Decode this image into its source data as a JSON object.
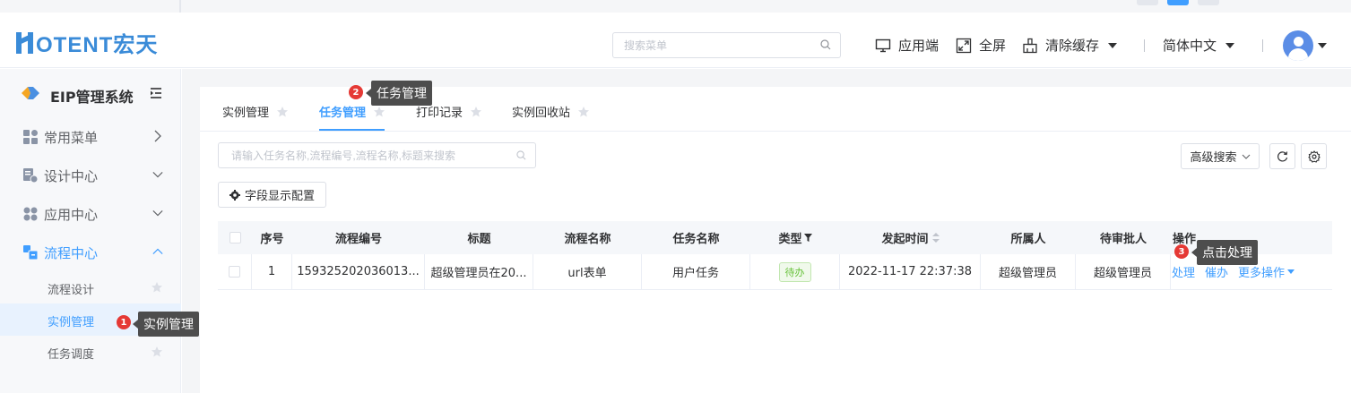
{
  "colors": {
    "brand": "#3a8bd8",
    "accent": "#409eff",
    "tip_bg": "#4d4d4d",
    "badge": "#e53935",
    "status_ok": "#67c23a"
  },
  "header": {
    "logo_text": "OTENT宏天",
    "search_placeholder": "搜索菜单",
    "app_client": "应用端",
    "fullscreen": "全屏",
    "clear_cache": "清除缓存",
    "language": "简体中文"
  },
  "sidebar": {
    "system_title": "EIP管理系统",
    "menu": [
      {
        "label": "常用菜单",
        "icon": "grid-icon",
        "arrow": "chevron-right"
      },
      {
        "label": "设计中心",
        "icon": "design-icon",
        "arrow": "chevron-down"
      },
      {
        "label": "应用中心",
        "icon": "apps-icon",
        "arrow": "chevron-down"
      },
      {
        "label": "流程中心",
        "icon": "flow-icon",
        "arrow": "chevron-up"
      }
    ],
    "sub_menu": [
      {
        "label": "流程设计"
      },
      {
        "label": "实例管理"
      },
      {
        "label": "任务调度"
      }
    ]
  },
  "tooltips": [
    {
      "num": "1",
      "text": "实例管理"
    },
    {
      "num": "2",
      "text": "任务管理"
    },
    {
      "num": "3",
      "text": "点击处理"
    }
  ],
  "tabs": [
    {
      "label": "实例管理"
    },
    {
      "label": "任务管理"
    },
    {
      "label": "打印记录"
    },
    {
      "label": "实例回收站"
    }
  ],
  "toolbar": {
    "search_placeholder": "请输入任务名称,流程编号,流程名称,标题来搜索",
    "advanced_search": "高级搜索",
    "field_config": "字段显示配置"
  },
  "table": {
    "columns": [
      "序号",
      "流程编号",
      "标题",
      "流程名称",
      "任务名称",
      "类型",
      "发起时间",
      "所属人",
      "待审批人",
      "操作"
    ],
    "rows": [
      {
        "index": "1",
        "flow_no": "159325202036013...",
        "title": "超级管理员在20...",
        "flow_name": "url表单",
        "task_name": "用户任务",
        "type": "待办",
        "start_time": "2022-11-17 22:37:38",
        "owner": "超级管理员",
        "approver": "超级管理员",
        "actions": {
          "handle": "处理",
          "urge": "催办",
          "more": "更多操作"
        }
      }
    ]
  }
}
